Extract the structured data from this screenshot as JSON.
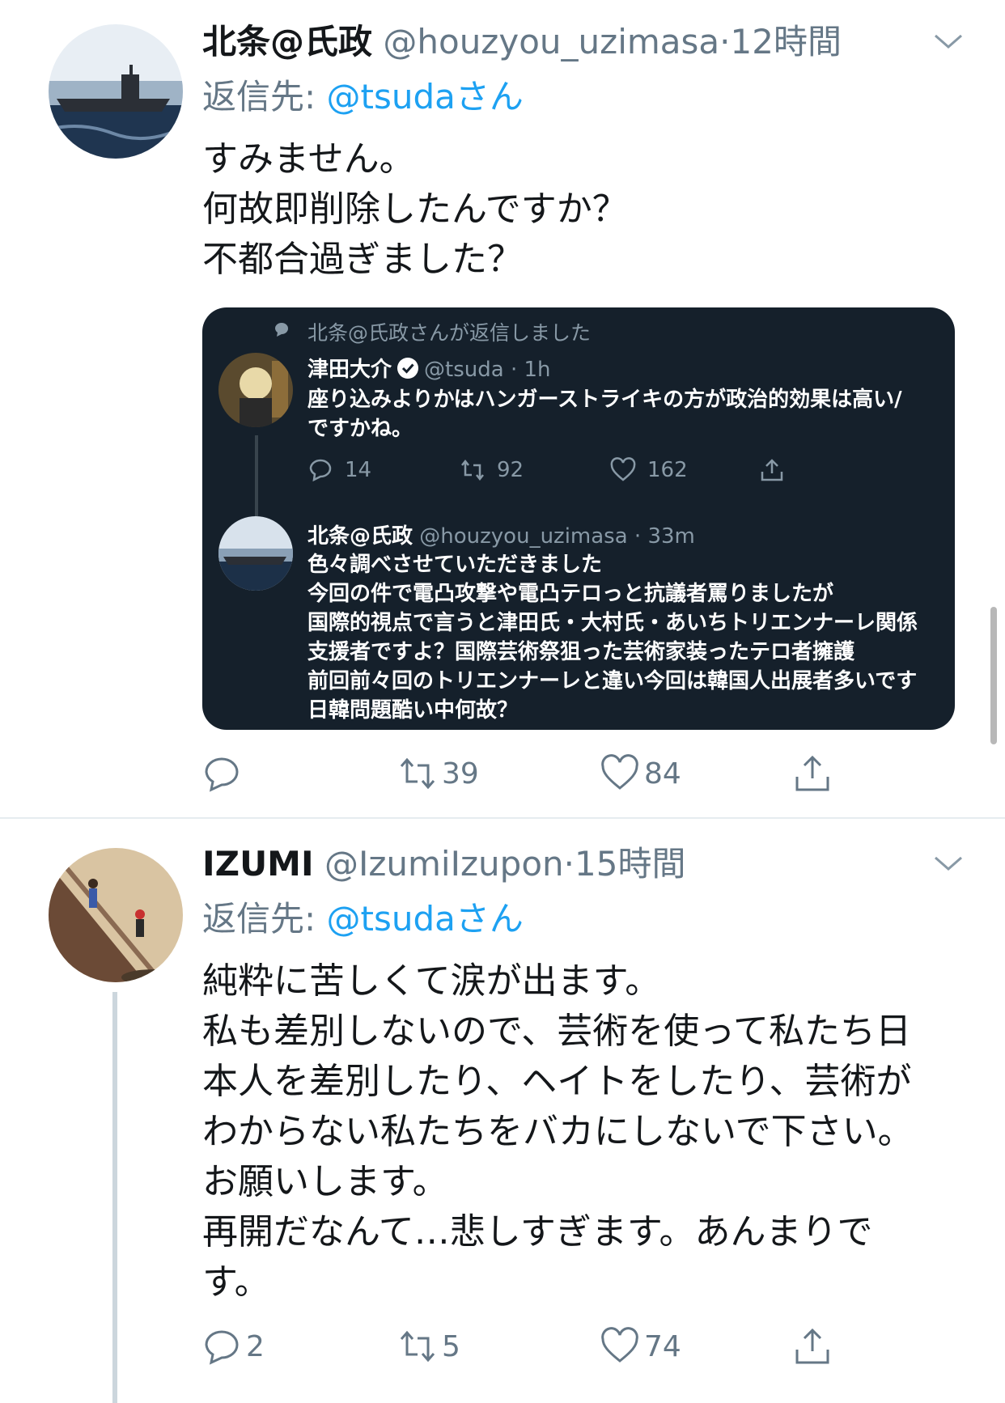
{
  "tweets": [
    {
      "name": "北条@氏政",
      "handle": "@houzyou_uzimasa",
      "dot": "·",
      "time": "12時間",
      "reply_prefix": "返信先: ",
      "reply_mention": "@tsudaさん",
      "lines": [
        "すみません。",
        "何故即削除したんですか？",
        "不都合過ぎました？"
      ],
      "reply_count": "",
      "retweet_count": "39",
      "like_count": "84"
    },
    {
      "name": "IZUMI",
      "handle": "@IzumiIzupon",
      "dot": "·",
      "time": "15時間",
      "reply_prefix": "返信先: ",
      "reply_mention": "@tsudaさん",
      "lines": [
        "純粋に苦しくて涙が出ます。",
        "私も差別しないので、芸術を使って私たち日",
        "本人を差別したり、ヘイトをしたり、芸術が",
        "わからない私たちをバカにしないで下さい。",
        "お願いします。",
        "再開だなんて…悲しすぎます。あんまりで",
        "す。"
      ],
      "reply_count": "2",
      "retweet_count": "5",
      "like_count": "74"
    }
  ],
  "embed": {
    "context": "北条@氏政さんが返信しました",
    "first": {
      "name": "津田大介",
      "handle": "@tsuda",
      "time": "· 1h",
      "lines": [
        "座り込みよりかはハンガーストライキの方が政治的効果は高い/",
        "ですかね。"
      ],
      "reply_count": "14",
      "retweet_count": "92",
      "like_count": "162"
    },
    "second": {
      "name": "北条@氏政",
      "handle": "@houzyou_uzimasa",
      "time": "· 33m",
      "lines": [
        "色々調べさせていただきました",
        "今回の件で電凸攻撃や電凸テロっと抗議者罵りましたが",
        "国際的視点で言うと津田氏・大村氏・あいちトリエンナーレ関係",
        "支援者ですよ？国際芸術祭狙った芸術家装ったテロ者擁護",
        "前回前々回のトリエンナーレと違い今回は韓国人出展者多いです",
        "日韓問題酷い中何故？"
      ]
    }
  },
  "colors": {
    "link": "#1da1f2",
    "secondary_text": "#657786",
    "embed_bg": "#15202b"
  }
}
